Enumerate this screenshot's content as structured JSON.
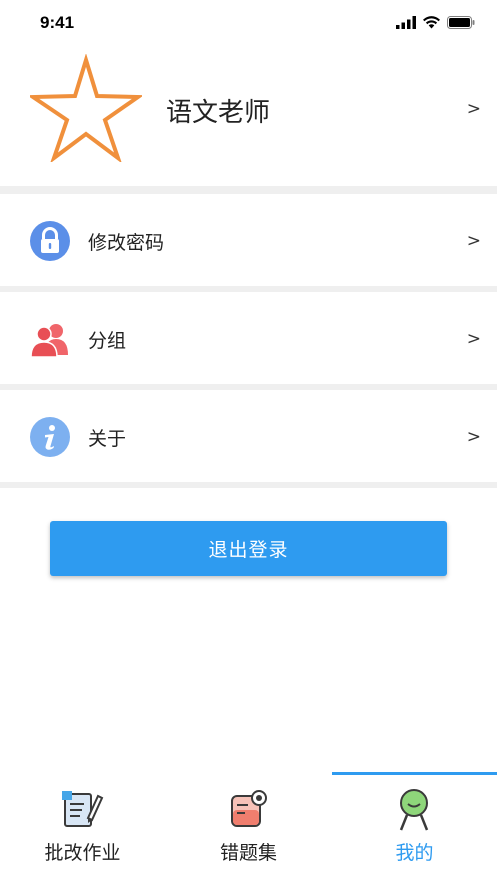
{
  "status_bar": {
    "time": "9:41"
  },
  "profile": {
    "name": "语文老师",
    "chevron": ">"
  },
  "menu": [
    {
      "label": "修改密码",
      "icon": "lock-icon",
      "chevron": ">"
    },
    {
      "label": "分组",
      "icon": "users-icon",
      "chevron": ">"
    },
    {
      "label": "关于",
      "icon": "info-icon",
      "chevron": ">"
    }
  ],
  "logout_label": "退出登录",
  "tabs": [
    {
      "label": "批改作业",
      "icon": "homework-icon",
      "active": false
    },
    {
      "label": "错题集",
      "icon": "mistakes-icon",
      "active": false
    },
    {
      "label": "我的",
      "icon": "profile-face-icon",
      "active": true
    }
  ],
  "colors": {
    "accent": "#2e9bf0",
    "separator": "#efefef",
    "star": "#f0903c"
  }
}
